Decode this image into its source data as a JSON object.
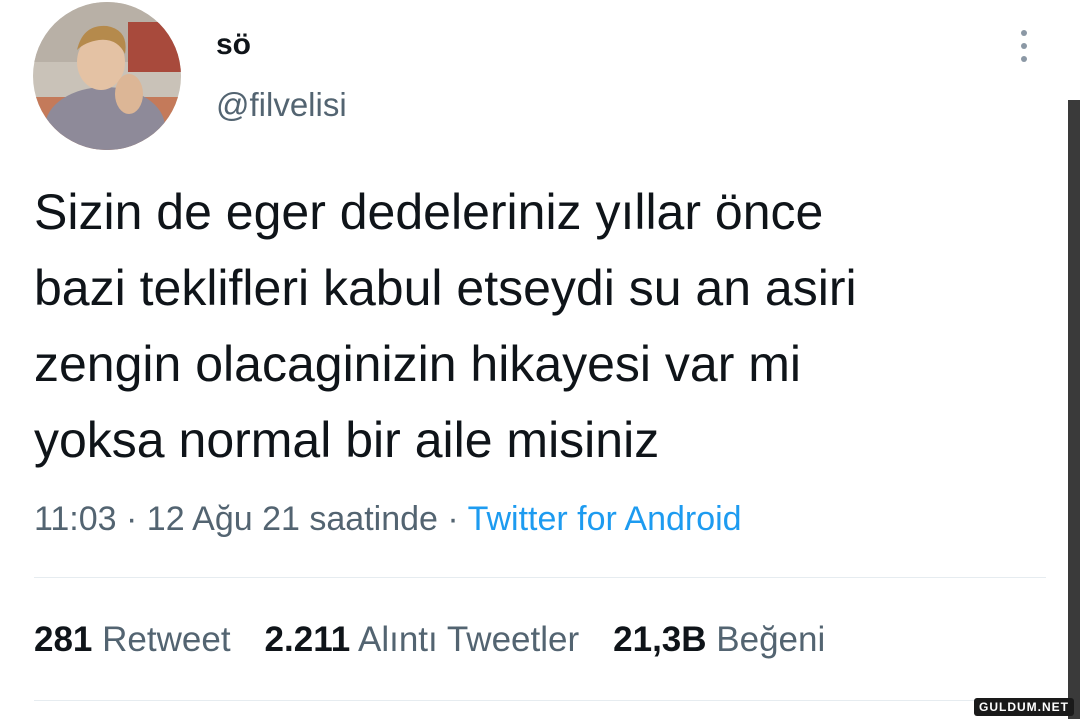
{
  "tweet": {
    "author": {
      "display_name": "sö",
      "handle": "@filvelisi",
      "avatar_icon": "profile-photo"
    },
    "text_lines": [
      "Sizin de eger dedeleriniz yıllar önce",
      "bazi teklifleri kabul etseydi su an asiri",
      "zengin olacaginizin hikayesi var mi",
      "yoksa normal bir aile misiniz"
    ],
    "time": "11:03",
    "separator": "·",
    "date": "12 Ağu 21 saatinde",
    "source": "Twitter for Android",
    "stats": {
      "retweets": {
        "count": "281",
        "label": "Retweet"
      },
      "quotes": {
        "count": "2.211",
        "label": "Alıntı Tweetler"
      },
      "likes": {
        "count": "21,3B",
        "label": "Beğeni"
      }
    },
    "more_icon": "more-vertical-icon"
  },
  "watermark": "GULDUM.NET",
  "colors": {
    "text": "#0f1419",
    "secondary": "#536471",
    "link": "#1d9bf0",
    "divider": "#e6ecf0"
  }
}
